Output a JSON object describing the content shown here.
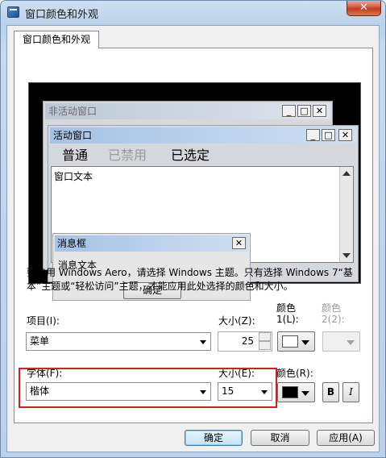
{
  "window": {
    "title": "窗口颜色和外观",
    "close_glyph": "✕"
  },
  "tab": {
    "label": "窗口颜色和外观"
  },
  "preview": {
    "inactive_window_title": "非活动窗口",
    "active_window_title": "活动窗口",
    "menu_normal": "普通",
    "menu_disabled": "已禁用",
    "menu_selected": "已选定",
    "window_text": "窗口文本",
    "message_box_title": "消息框",
    "message_text": "消息文本",
    "ok_label": "确定",
    "min_glyph": "_",
    "max_glyph": "□",
    "close_glyph": "✕"
  },
  "description": "要启用 Windows Aero，请选择 Windows 主题。只有选择 Windows 7“基本”主题或“轻松访问”主题，才能应用此处选择的颜色和大小。",
  "item": {
    "label": "项目(I):",
    "value": "菜单",
    "size_label": "大小(Z):",
    "size_value": "25",
    "color1_label_a": "颜色",
    "color1_label_b": "1(L):",
    "color2_label_a": "颜色",
    "color2_label_b": "2(2):",
    "color1": "#ffffff"
  },
  "font": {
    "label": "字体(F):",
    "value": "楷体",
    "size_label": "大小(E):",
    "size_value": "15",
    "color_label": "颜色(R):",
    "color": "#000000",
    "bold_label": "B",
    "italic_label": "I"
  },
  "buttons": {
    "ok": "确定",
    "cancel": "取消",
    "apply": "应用(A)"
  },
  "colors": {
    "highlight_box": "#d02020",
    "active_title": "#a6c2e4"
  }
}
